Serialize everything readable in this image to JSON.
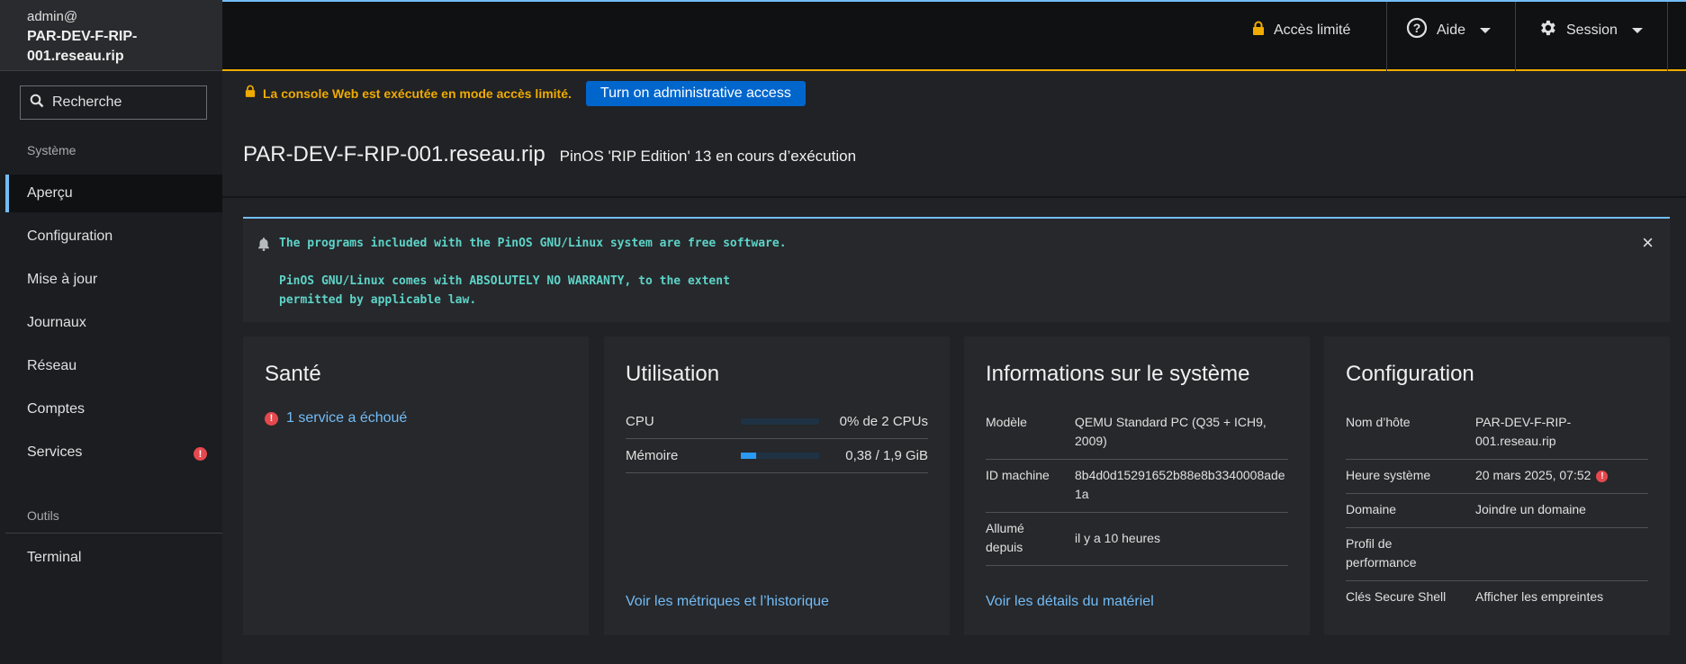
{
  "sidebar": {
    "user": "admin@",
    "hostname_line1": "PAR-DEV-F-RIP-",
    "hostname_line2": "001.reseau.rip",
    "search_placeholder": "Recherche",
    "section_system": "Système",
    "items": [
      {
        "label": "Aperçu"
      },
      {
        "label": "Configuration"
      },
      {
        "label": "Mise à jour"
      },
      {
        "label": "Journaux"
      },
      {
        "label": "Réseau"
      },
      {
        "label": "Comptes"
      },
      {
        "label": "Services",
        "badge": "!"
      }
    ],
    "section_tools": "Outils",
    "tools": [
      {
        "label": "Terminal"
      }
    ]
  },
  "topbar": {
    "limited_access": "Accès limité",
    "help": "Aide",
    "session": "Session"
  },
  "warning": {
    "text": "La console Web est exécutée en mode accès limité.",
    "button": "Turn on administrative access"
  },
  "page": {
    "hostname": "PAR-DEV-F-RIP-001.reseau.rip",
    "os_status": "PinOS 'RIP Edition' 13 en cours d’exécution"
  },
  "motd": {
    "line1": "The programs included with the PinOS GNU/Linux system are free software.",
    "line2": "PinOS GNU/Linux comes with ABSOLUTELY NO WARRANTY, to the extent",
    "line3": "permitted by applicable law.",
    "close": "×"
  },
  "health": {
    "title": "Santé",
    "failed": "1 service a échoué"
  },
  "usage": {
    "title": "Utilisation",
    "cpu_label": "CPU",
    "cpu_value": "0% de 2 CPUs",
    "cpu_fraction": 0.0,
    "mem_label": "Mémoire",
    "mem_value": "0,38 / 1,9 GiB",
    "mem_fraction": 0.2,
    "link": "Voir les métriques et l’historique"
  },
  "sysinfo": {
    "title": "Informations sur le système",
    "model_label": "Modèle",
    "model_value": "QEMU Standard PC (Q35 + ICH9, 2009)",
    "machine_id_label": "ID machine",
    "machine_id_value": "8b4d0d15291652b88e8b3340008ade1a",
    "uptime_label": "Allumé depuis",
    "uptime_value": "il y a 10 heures",
    "link": "Voir les détails du matériel"
  },
  "config": {
    "title": "Configuration",
    "hostname_label": "Nom d’hôte",
    "hostname_value": "PAR-DEV-F-RIP-001.reseau.rip",
    "time_label": "Heure système",
    "time_value": "20 mars 2025, 07:52",
    "domain_label": "Domaine",
    "domain_value": "Joindre un domaine",
    "perf_label": "Profil de performance",
    "ssh_label": "Clés Secure Shell",
    "ssh_value": "Afficher les empreintes"
  },
  "colors": {
    "accent": "#73bcf7",
    "warning": "#f0ab00",
    "danger": "#e5484d",
    "primary_button": "#0066cc"
  }
}
